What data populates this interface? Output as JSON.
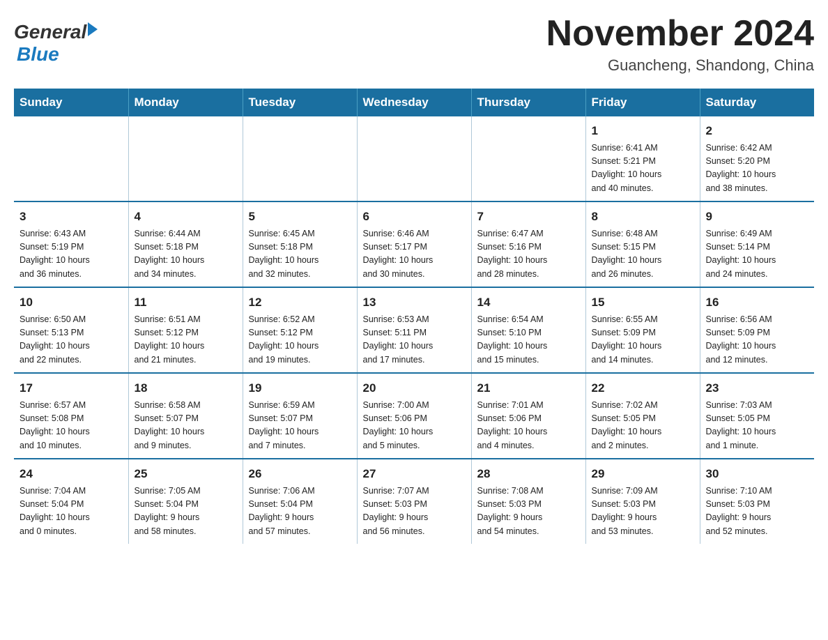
{
  "header": {
    "logo_general": "General",
    "logo_blue": "Blue",
    "title": "November 2024",
    "subtitle": "Guancheng, Shandong, China"
  },
  "weekdays": [
    "Sunday",
    "Monday",
    "Tuesday",
    "Wednesday",
    "Thursday",
    "Friday",
    "Saturday"
  ],
  "weeks": [
    [
      {
        "day": "",
        "info": ""
      },
      {
        "day": "",
        "info": ""
      },
      {
        "day": "",
        "info": ""
      },
      {
        "day": "",
        "info": ""
      },
      {
        "day": "",
        "info": ""
      },
      {
        "day": "1",
        "info": "Sunrise: 6:41 AM\nSunset: 5:21 PM\nDaylight: 10 hours\nand 40 minutes."
      },
      {
        "day": "2",
        "info": "Sunrise: 6:42 AM\nSunset: 5:20 PM\nDaylight: 10 hours\nand 38 minutes."
      }
    ],
    [
      {
        "day": "3",
        "info": "Sunrise: 6:43 AM\nSunset: 5:19 PM\nDaylight: 10 hours\nand 36 minutes."
      },
      {
        "day": "4",
        "info": "Sunrise: 6:44 AM\nSunset: 5:18 PM\nDaylight: 10 hours\nand 34 minutes."
      },
      {
        "day": "5",
        "info": "Sunrise: 6:45 AM\nSunset: 5:18 PM\nDaylight: 10 hours\nand 32 minutes."
      },
      {
        "day": "6",
        "info": "Sunrise: 6:46 AM\nSunset: 5:17 PM\nDaylight: 10 hours\nand 30 minutes."
      },
      {
        "day": "7",
        "info": "Sunrise: 6:47 AM\nSunset: 5:16 PM\nDaylight: 10 hours\nand 28 minutes."
      },
      {
        "day": "8",
        "info": "Sunrise: 6:48 AM\nSunset: 5:15 PM\nDaylight: 10 hours\nand 26 minutes."
      },
      {
        "day": "9",
        "info": "Sunrise: 6:49 AM\nSunset: 5:14 PM\nDaylight: 10 hours\nand 24 minutes."
      }
    ],
    [
      {
        "day": "10",
        "info": "Sunrise: 6:50 AM\nSunset: 5:13 PM\nDaylight: 10 hours\nand 22 minutes."
      },
      {
        "day": "11",
        "info": "Sunrise: 6:51 AM\nSunset: 5:12 PM\nDaylight: 10 hours\nand 21 minutes."
      },
      {
        "day": "12",
        "info": "Sunrise: 6:52 AM\nSunset: 5:12 PM\nDaylight: 10 hours\nand 19 minutes."
      },
      {
        "day": "13",
        "info": "Sunrise: 6:53 AM\nSunset: 5:11 PM\nDaylight: 10 hours\nand 17 minutes."
      },
      {
        "day": "14",
        "info": "Sunrise: 6:54 AM\nSunset: 5:10 PM\nDaylight: 10 hours\nand 15 minutes."
      },
      {
        "day": "15",
        "info": "Sunrise: 6:55 AM\nSunset: 5:09 PM\nDaylight: 10 hours\nand 14 minutes."
      },
      {
        "day": "16",
        "info": "Sunrise: 6:56 AM\nSunset: 5:09 PM\nDaylight: 10 hours\nand 12 minutes."
      }
    ],
    [
      {
        "day": "17",
        "info": "Sunrise: 6:57 AM\nSunset: 5:08 PM\nDaylight: 10 hours\nand 10 minutes."
      },
      {
        "day": "18",
        "info": "Sunrise: 6:58 AM\nSunset: 5:07 PM\nDaylight: 10 hours\nand 9 minutes."
      },
      {
        "day": "19",
        "info": "Sunrise: 6:59 AM\nSunset: 5:07 PM\nDaylight: 10 hours\nand 7 minutes."
      },
      {
        "day": "20",
        "info": "Sunrise: 7:00 AM\nSunset: 5:06 PM\nDaylight: 10 hours\nand 5 minutes."
      },
      {
        "day": "21",
        "info": "Sunrise: 7:01 AM\nSunset: 5:06 PM\nDaylight: 10 hours\nand 4 minutes."
      },
      {
        "day": "22",
        "info": "Sunrise: 7:02 AM\nSunset: 5:05 PM\nDaylight: 10 hours\nand 2 minutes."
      },
      {
        "day": "23",
        "info": "Sunrise: 7:03 AM\nSunset: 5:05 PM\nDaylight: 10 hours\nand 1 minute."
      }
    ],
    [
      {
        "day": "24",
        "info": "Sunrise: 7:04 AM\nSunset: 5:04 PM\nDaylight: 10 hours\nand 0 minutes."
      },
      {
        "day": "25",
        "info": "Sunrise: 7:05 AM\nSunset: 5:04 PM\nDaylight: 9 hours\nand 58 minutes."
      },
      {
        "day": "26",
        "info": "Sunrise: 7:06 AM\nSunset: 5:04 PM\nDaylight: 9 hours\nand 57 minutes."
      },
      {
        "day": "27",
        "info": "Sunrise: 7:07 AM\nSunset: 5:03 PM\nDaylight: 9 hours\nand 56 minutes."
      },
      {
        "day": "28",
        "info": "Sunrise: 7:08 AM\nSunset: 5:03 PM\nDaylight: 9 hours\nand 54 minutes."
      },
      {
        "day": "29",
        "info": "Sunrise: 7:09 AM\nSunset: 5:03 PM\nDaylight: 9 hours\nand 53 minutes."
      },
      {
        "day": "30",
        "info": "Sunrise: 7:10 AM\nSunset: 5:03 PM\nDaylight: 9 hours\nand 52 minutes."
      }
    ]
  ]
}
